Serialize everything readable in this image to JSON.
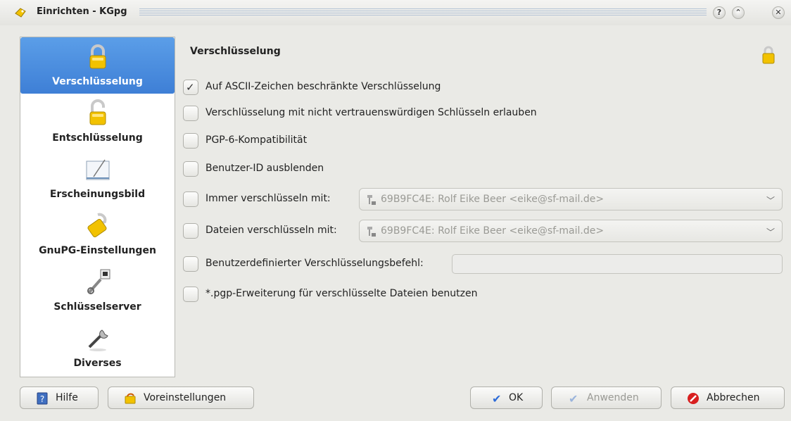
{
  "window": {
    "title": "Einrichten - KGpg",
    "help_button": "?",
    "collapse_button": "⌃",
    "close_button": "✕"
  },
  "sidebar": {
    "items": [
      {
        "label": "Verschlüsselung",
        "icon": "lock-closed-icon",
        "selected": true
      },
      {
        "label": "Entschlüsselung",
        "icon": "lock-open-icon",
        "selected": false
      },
      {
        "label": "Erscheinungsbild",
        "icon": "appearance-icon",
        "selected": false
      },
      {
        "label": "GnuPG-Einstellungen",
        "icon": "gnupg-icon",
        "selected": false
      },
      {
        "label": "Schlüsselserver",
        "icon": "keyserver-icon",
        "selected": false
      },
      {
        "label": "Diverses",
        "icon": "misc-tools-icon",
        "selected": false
      }
    ]
  },
  "main": {
    "title": "Verschlüsselung",
    "options": [
      {
        "label": "Auf ASCII-Zeichen beschränkte Verschlüsselung",
        "checked": true
      },
      {
        "label": "Verschlüsselung mit nicht vertrauenswürdigen Schlüsseln erlauben",
        "checked": false
      },
      {
        "label": "PGP-6-Kompatibilität",
        "checked": false
      },
      {
        "label": "Benutzer-ID ausblenden",
        "checked": false
      },
      {
        "label": "Immer verschlüsseln mit:",
        "checked": false
      },
      {
        "label": "Dateien verschlüsseln mit:",
        "checked": false
      },
      {
        "label": "Benutzerdefinierter Verschlüsselungsbefehl:",
        "checked": false
      },
      {
        "label": "*.pgp-Erweiterung für verschlüsselte Dateien benutzen",
        "checked": false
      }
    ],
    "always_encrypt_key": "69B9FC4E: Rolf Eike Beer <eike@sf-mail.de>",
    "files_encrypt_key": "69B9FC4E: Rolf Eike Beer <eike@sf-mail.de>",
    "custom_command_value": ""
  },
  "buttons": {
    "help": "Hilfe",
    "defaults": "Voreinstellungen",
    "ok": "OK",
    "apply": "Anwenden",
    "cancel": "Abbrechen"
  },
  "colors": {
    "accent": "#3e7fd6",
    "lock_gold": "#f2c200",
    "cancel_red": "#d81f1f"
  }
}
